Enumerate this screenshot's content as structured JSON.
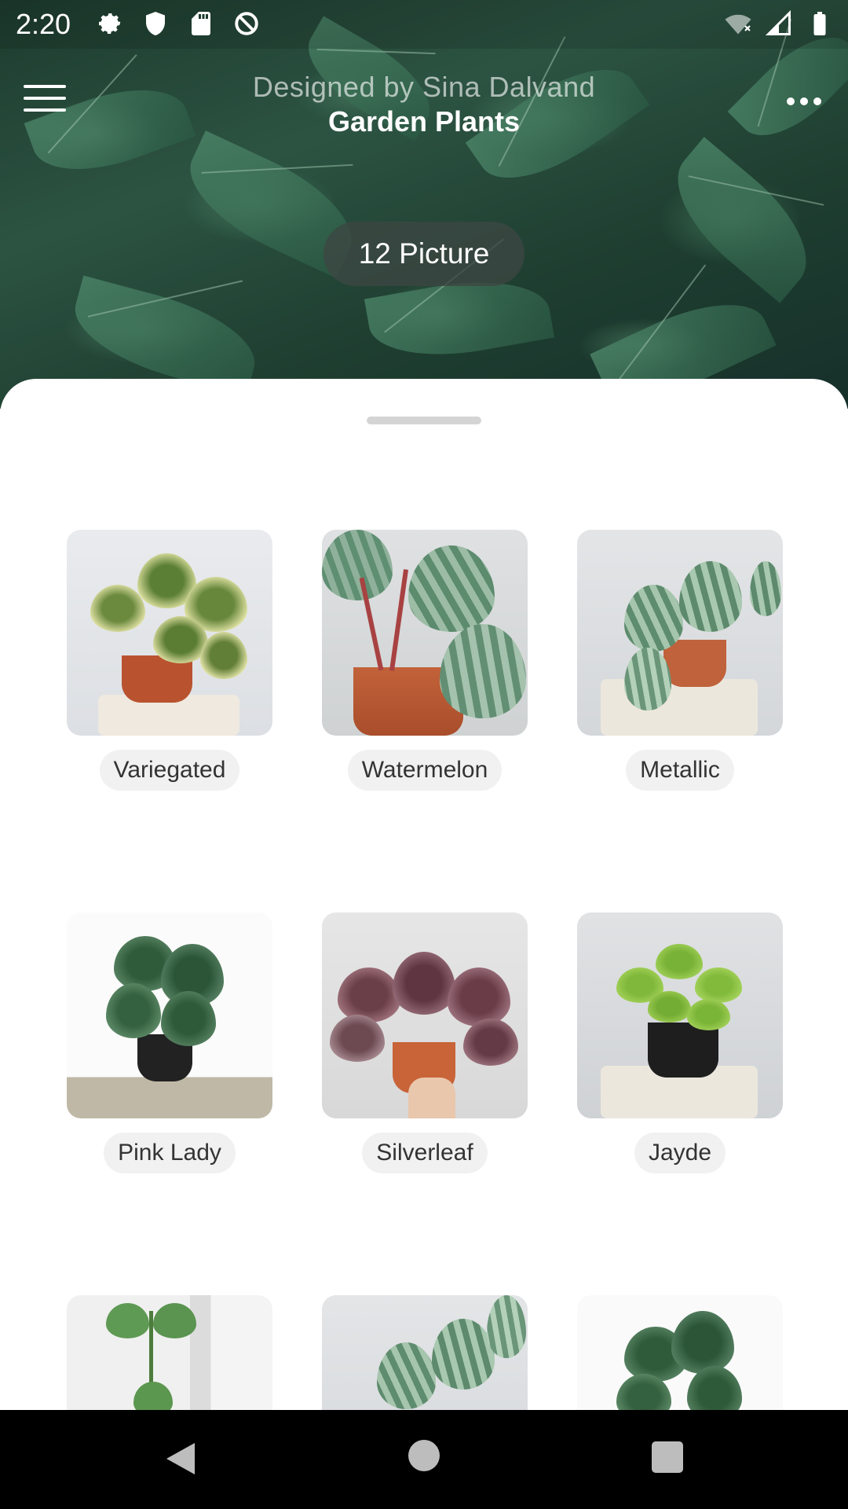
{
  "status_bar": {
    "time": "2:20",
    "left_icons": [
      "gear-icon",
      "shield-icon",
      "sd-card-icon",
      "data-saver-icon"
    ],
    "right_icons": [
      "wifi-off-icon",
      "signal-icon",
      "battery-icon"
    ]
  },
  "app_bar": {
    "subtitle": "Designed by Sina Dalvand",
    "title": "Garden Plants"
  },
  "gallery": {
    "count_label": "12 Picture",
    "items": [
      {
        "label": "Variegated"
      },
      {
        "label": "Watermelon"
      },
      {
        "label": "Metallic"
      },
      {
        "label": "Pink Lady"
      },
      {
        "label": "Silverleaf"
      },
      {
        "label": "Jayde"
      }
    ]
  },
  "colors": {
    "hero": "#2c5342",
    "sheet": "#ffffff",
    "label_bg": "#f1f1f1",
    "nav_bar": "#000000"
  }
}
